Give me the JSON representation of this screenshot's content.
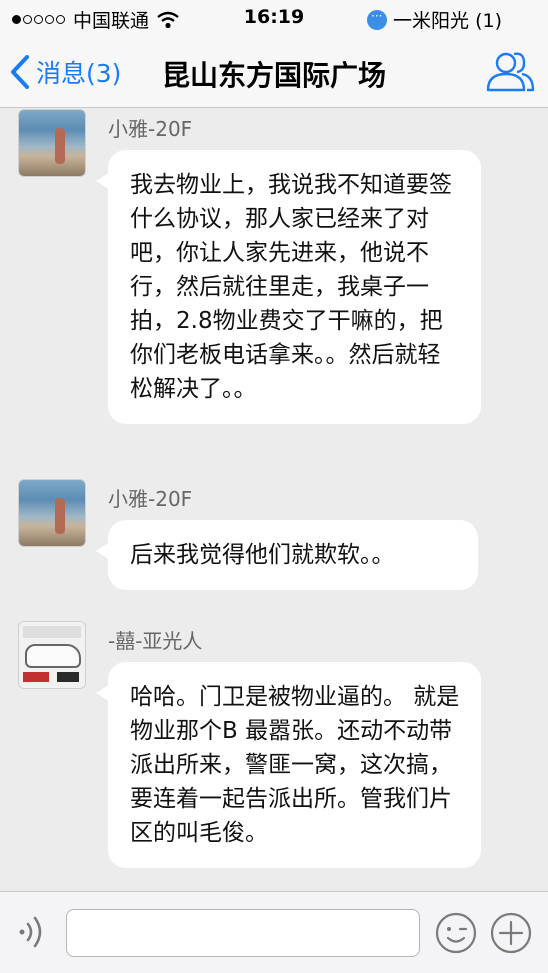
{
  "status_bar": {
    "carrier": "中国联通",
    "time": "16:19",
    "notification": "一米阳光 (1)"
  },
  "nav": {
    "back_label": "消息(3)",
    "title": "昆山东方国际广场"
  },
  "messages": [
    {
      "sender": "小雅-20F",
      "text": "我去物业上，我说我不知道要签什么协议，那人家已经来了对吧，你让人家先进来，他说不行，然后就往里走，我桌子一拍，2.8物业费交了干嘛的，把你们老板电话拿来。。然后就轻松解决了。。"
    },
    {
      "sender": "小雅-20F",
      "text": "后来我觉得他们就欺软。。"
    },
    {
      "sender": "-囍-亚光人",
      "text": "哈哈。门卫是被物业逼的。 就是物业那个B 最嚣张。还动不动带派出所来，警匪一窝，这次搞，要连着一起告派出所。管我们片区的叫毛俊。"
    }
  ],
  "input": {
    "value": "",
    "placeholder": ""
  },
  "icons": {
    "back": "chevron-left-icon",
    "contacts": "group-contacts-icon",
    "voice": "voice-icon",
    "emoji": "emoji-icon",
    "more": "plus-icon",
    "wifi": "wifi-icon"
  },
  "colors": {
    "accent": "#1a7cf5",
    "chat_background": "#ececec",
    "bubble": "#ffffff"
  }
}
